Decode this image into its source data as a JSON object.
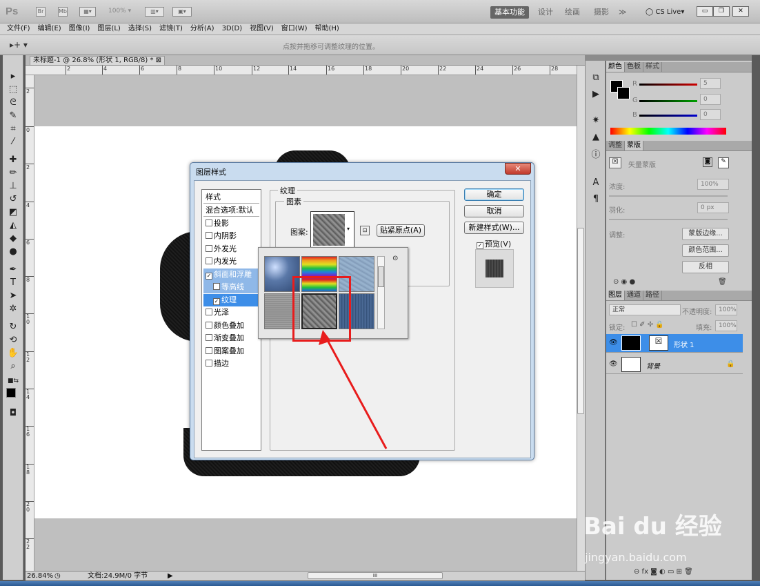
{
  "app": {
    "logo": "Ps",
    "zoom": "100%",
    "workspaces": [
      "基本功能",
      "设计",
      "绘画",
      "摄影",
      "≫"
    ],
    "cslive": "CS Live"
  },
  "menu": [
    "文件(F)",
    "编辑(E)",
    "图像(I)",
    "图层(L)",
    "选择(S)",
    "滤镜(T)",
    "分析(A)",
    "3D(D)",
    "视图(V)",
    "窗口(W)",
    "帮助(H)"
  ],
  "options": {
    "tool_icon": "▸+",
    "hint": "点按并拖移可调整纹理的位置。"
  },
  "document": {
    "tab_title": "未标题-1 @ 26.8% (形状 1, RGB/8) *",
    "ruler_top": [
      "2",
      "4",
      "6",
      "8",
      "10",
      "12",
      "14",
      "16",
      "18",
      "20",
      "22",
      "24",
      "26",
      "28"
    ],
    "ruler_left": [
      "2",
      "0",
      "2",
      "4",
      "6",
      "8",
      "1\n0",
      "1\n2",
      "1\n4",
      "1\n6",
      "1\n8",
      "2\n0",
      "2\n2"
    ],
    "status_zoom": "26.84%",
    "status_doc": "文档:24.9M/0 字节"
  },
  "color_panel": {
    "tabs": [
      "颜色",
      "色板",
      "样式"
    ],
    "channels": [
      {
        "label": "R",
        "value": "5",
        "color": "#d00000"
      },
      {
        "label": "G",
        "value": "0",
        "color": "#00a000"
      },
      {
        "label": "B",
        "value": "0",
        "color": "#0000d0"
      }
    ]
  },
  "mask_panel": {
    "tabs": [
      "调整",
      "蒙版"
    ],
    "title": "矢量蒙版",
    "density_label": "浓度:",
    "density_value": "100%",
    "feather_label": "羽化:",
    "feather_value": "0 px",
    "adjust_label": "调整:",
    "btn_edge": "蒙版边缘...",
    "btn_color_range": "颜色范围...",
    "btn_invert": "反相"
  },
  "layers_panel": {
    "tabs": [
      "图层",
      "通道",
      "路径"
    ],
    "blend_mode": "正常",
    "opacity_label": "不透明度:",
    "opacity": "100%",
    "lock_label": "锁定:",
    "fill_label": "填充:",
    "fill": "100%",
    "layers": [
      {
        "name": "形状 1",
        "selected": true
      },
      {
        "name": "背景",
        "selected": false
      }
    ]
  },
  "dialog": {
    "title": "图层样式",
    "styles_header": "样式",
    "blend_options": "混合选项:默认",
    "styles": [
      {
        "label": "投影",
        "checked": false
      },
      {
        "label": "内阴影",
        "checked": false
      },
      {
        "label": "外发光",
        "checked": false
      },
      {
        "label": "内发光",
        "checked": false
      },
      {
        "label": "斜面和浮雕",
        "checked": true
      },
      {
        "label": "等高线",
        "checked": false
      },
      {
        "label": "纹理",
        "checked": true
      },
      {
        "label": "光泽",
        "checked": false
      },
      {
        "label": "颜色叠加",
        "checked": false
      },
      {
        "label": "渐变叠加",
        "checked": false
      },
      {
        "label": "图案叠加",
        "checked": false
      },
      {
        "label": "描边",
        "checked": false
      }
    ],
    "group_texture": "纹理",
    "group_elements": "图素",
    "pattern_label": "图案:",
    "snap_button": "贴紧原点(A)",
    "ok": "确定",
    "cancel": "取消",
    "new_style": "新建样式(W)...",
    "preview": "预览(V)"
  },
  "watermark": {
    "text": "Bai du 经验",
    "url": "jingyan.baidu.com"
  },
  "colors": {
    "accent": "#3d8ee8",
    "highlight_box": "#e81c1c"
  }
}
